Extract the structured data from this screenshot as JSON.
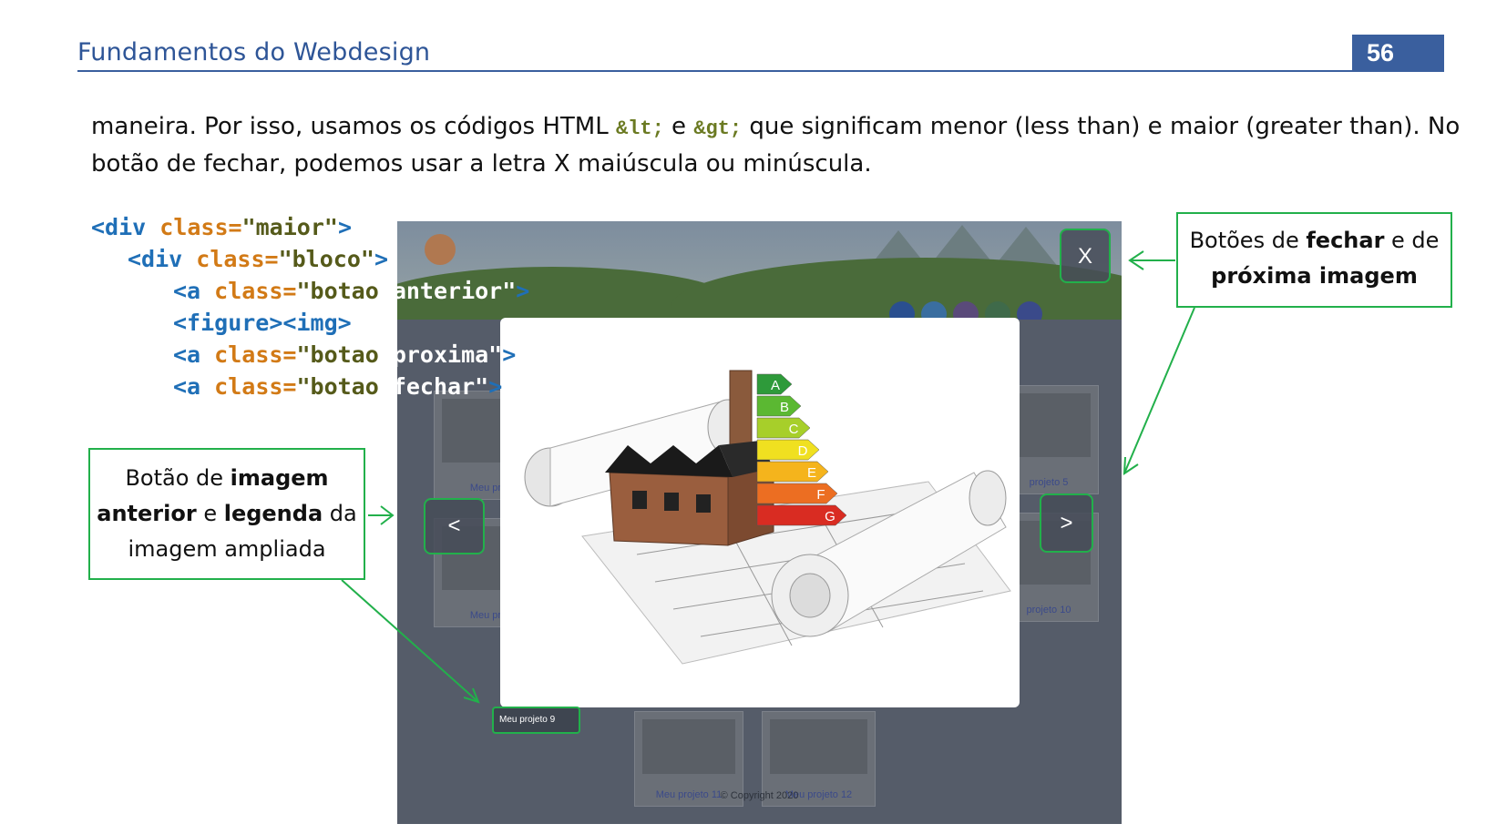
{
  "header": {
    "title": "Fundamentos do Webdesign",
    "page_number": "56"
  },
  "paragraph": {
    "line1_a": "maneira. Por isso, usamos os códigos HTML ",
    "entity_lt": "&lt;",
    "line1_b": " e ",
    "entity_gt": "&gt;",
    "line1_c": " que significam menor (less than) e maior (greater than).  No",
    "line2": "botão de fechar, podemos usar a letra X maiúscula ou minúscula."
  },
  "code": {
    "l1_tag_open": "<div",
    "l1_attr": " class=",
    "l1_val": "\"maior\"",
    "l1_close": ">",
    "l2_tag_open": "<div",
    "l2_attr": " class=",
    "l2_val": "\"bloco\"",
    "l2_close": ">",
    "l3_tag_open": "<a",
    "l3_attr": " class=",
    "l3_val_a": "\"botao ",
    "l3_val_b": "anterior\"",
    "l3_close": ">",
    "l4_text": "<figure><img>",
    "l5_tag_open": "<a",
    "l5_attr": " class=",
    "l5_val_a": "\"botao ",
    "l5_val_b": "proxima\"",
    "l5_close": ">",
    "l6_tag_open": "<a",
    "l6_attr": " class=",
    "l6_val_a": "\"botao ",
    "l6_val_b": "fechar\"",
    "l6_close": ">"
  },
  "screenshot": {
    "close_label": "X",
    "prev_label": "<",
    "next_label": ">",
    "caption": "Meu projeto 9",
    "thumbs": {
      "left_top": "Meu pro",
      "left_bottom": "Meu pro",
      "right_top": "projeto 5",
      "right_bottom": "projeto 10",
      "bottom_1": "Meu projeto 11",
      "bottom_2": "Meu projeto 12"
    },
    "copyright": "© Copyright 2020",
    "image_letters": [
      "A",
      "B",
      "C",
      "D",
      "E",
      "F",
      "G"
    ],
    "energy_colors": [
      "#2e9a3a",
      "#5bb832",
      "#a7cf2a",
      "#f0e020",
      "#f5b41c",
      "#ec6e22",
      "#d92c22"
    ]
  },
  "callouts": {
    "right": {
      "p1": "Botões de ",
      "b1": "fechar",
      "p2": " e de",
      "b2": "próxima imagem"
    },
    "left": {
      "p1": "Botão de ",
      "b1": "imagem",
      "b2": "anterior",
      "p2": " e ",
      "b3": "legenda",
      "p3": " da",
      "p4": "imagem ampliada"
    }
  }
}
